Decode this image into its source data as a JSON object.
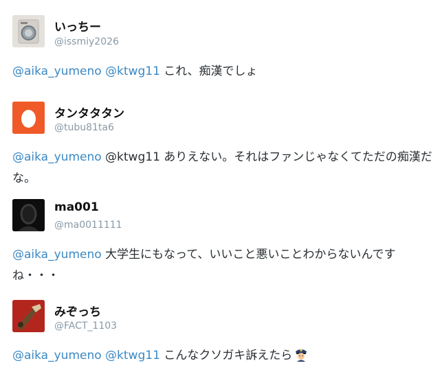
{
  "tweets": [
    {
      "name": "いっちー",
      "handle": "@issmiy2026",
      "avatar": "washing-machine-photo-avatar",
      "mentions": [
        "@aika_yumeno",
        "@ktwg11"
      ],
      "text": " これ、痴漢でしょ"
    },
    {
      "name": "タンタタタン",
      "handle": "@tubu81ta6",
      "avatar": "egg-default-avatar",
      "mentions": [
        "@aika_yumeno",
        "@ktwg11"
      ],
      "text": " ありえない。それはファンじゃなくてただの痴漢だな。"
    },
    {
      "name": "ma001",
      "handle": "@ma0011111",
      "avatar": "dark-face-avatar",
      "mentions": [
        "@aika_yumeno"
      ],
      "text": " 大学生にもなって、いいこと悪いことわからないんですね・・・"
    },
    {
      "name": "みぞっち",
      "handle": "@FACT_1103",
      "avatar": "red-item-avatar",
      "mentions": [
        "@aika_yumeno",
        "@ktwg11"
      ],
      "text": " こんなクソガキ訴えたら",
      "emoji": "police-officer-icon"
    }
  ],
  "colors": {
    "link": "#3b88c3",
    "handle": "#8899a6",
    "egg_bg": "#f05a28"
  }
}
